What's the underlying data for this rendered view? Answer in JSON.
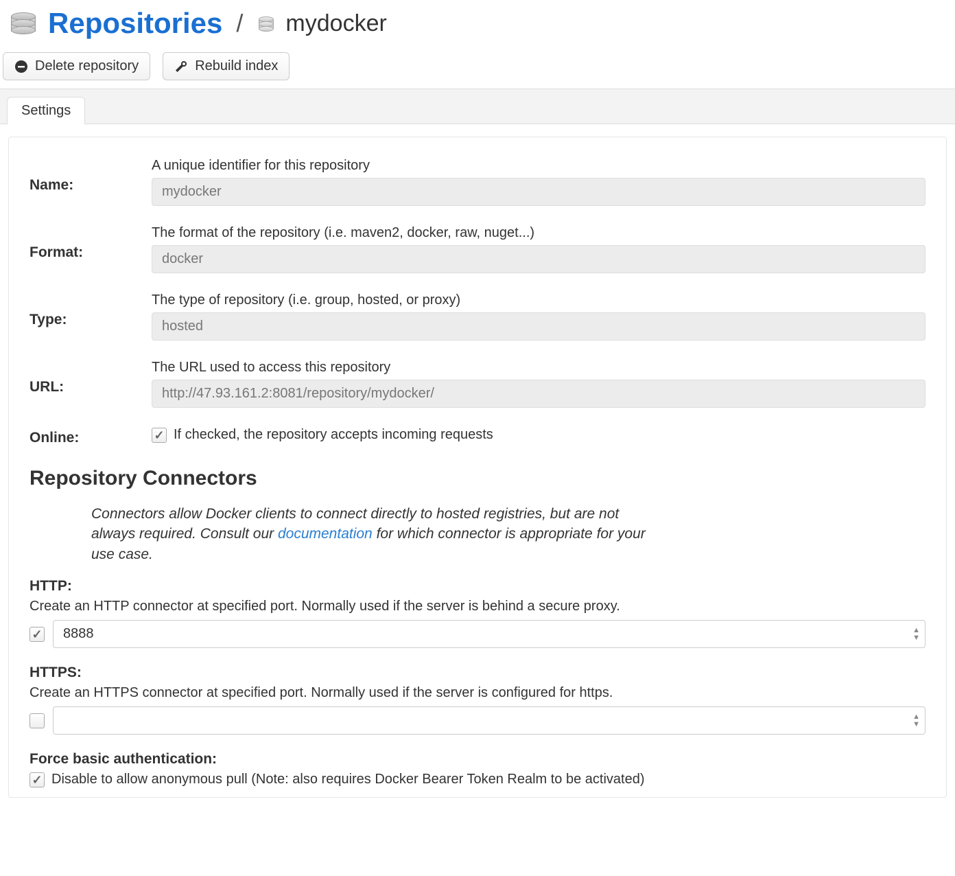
{
  "header": {
    "title": "Repositories",
    "separator": "/",
    "crumb_name": "mydocker"
  },
  "toolbar": {
    "delete_label": "Delete repository",
    "rebuild_label": "Rebuild index"
  },
  "tabs": {
    "settings_label": "Settings"
  },
  "form": {
    "name": {
      "label": "Name:",
      "help": "A unique identifier for this repository",
      "value": "mydocker"
    },
    "format": {
      "label": "Format:",
      "help": "The format of the repository (i.e. maven2, docker, raw, nuget...)",
      "value": "docker"
    },
    "type": {
      "label": "Type:",
      "help": "The type of repository (i.e. group, hosted, or proxy)",
      "value": "hosted"
    },
    "url": {
      "label": "URL:",
      "help": "The URL used to access this repository",
      "value": "http://47.93.161.2:8081/repository/mydocker/"
    },
    "online": {
      "label": "Online:",
      "help": "If checked, the repository accepts incoming requests",
      "checked": true
    }
  },
  "connectors": {
    "title": "Repository Connectors",
    "desc_before": "Connectors allow Docker clients to connect directly to hosted registries, but are not always required. Consult our ",
    "desc_link": "documentation",
    "desc_after": " for which connector is appropriate for your use case.",
    "http": {
      "label": "HTTP:",
      "help": "Create an HTTP connector at specified port. Normally used if the server is behind a secure proxy.",
      "checked": true,
      "value": "8888"
    },
    "https": {
      "label": "HTTPS:",
      "help": "Create an HTTPS connector at specified port. Normally used if the server is configured for https.",
      "checked": false,
      "value": ""
    },
    "force_basic": {
      "label": "Force basic authentication:",
      "help": "Disable to allow anonymous pull (Note: also requires Docker Bearer Token Realm to be activated)",
      "checked": true
    }
  }
}
